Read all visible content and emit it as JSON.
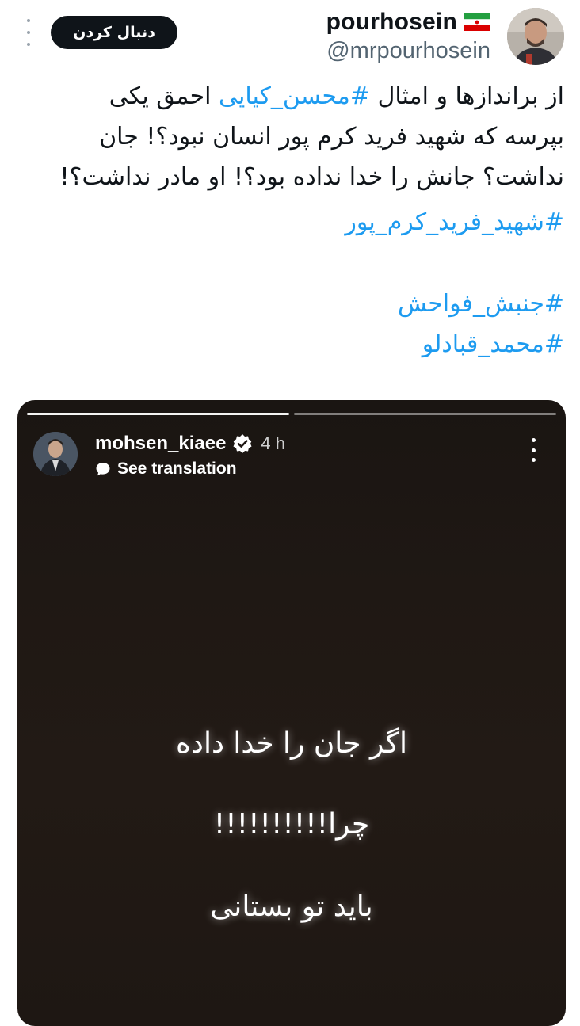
{
  "header": {
    "display_name": "pourhosein",
    "handle": "@mrpourhosein",
    "follow_label": "دنبال کردن",
    "flag_icon": "iran-flag-icon",
    "more_icon": "more-vertical-icon"
  },
  "tweet": {
    "line1_pre": "از براندازها و امثال ",
    "line1_tag": "#محسن_کیایی",
    "line1_post": " احمق یکی",
    "line2": "بپرسه که شهید فرید کرم پور انسان نبود؟! جان",
    "line3": "نداشت؟ جانش را خدا نداده بود؟! او مادر نداشت؟!",
    "hashtags": [
      "#شهید_فرید_کرم_پور",
      "#جنبش_فواحش",
      "#محمد_قبادلو"
    ]
  },
  "story": {
    "username": "mohsen_kiaee",
    "time": "4 h",
    "translate_label": "See translation",
    "lines": [
      "اگر جان را خدا داده",
      "چرا!!!!!!!!!!",
      "باید تو بستانی"
    ],
    "verified_icon": "verified-badge-icon",
    "more_icon": "more-vertical-icon"
  },
  "colors": {
    "link": "#1d9bf0",
    "text": "#0f1419",
    "muted": "#536471",
    "story_bg": "#1f1814"
  }
}
